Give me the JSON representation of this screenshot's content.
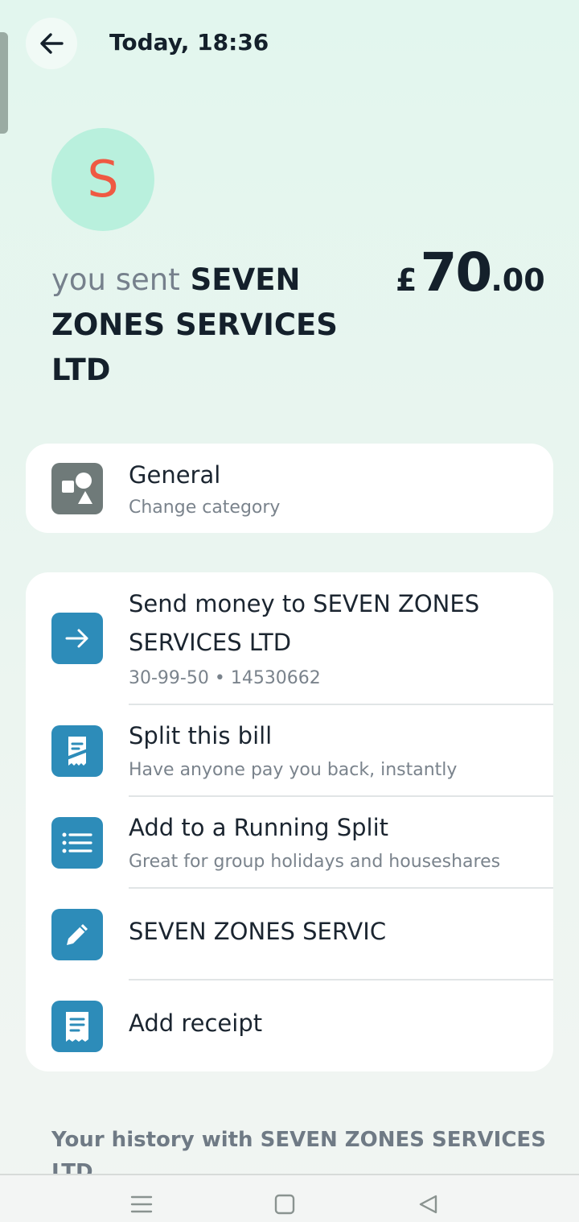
{
  "header": {
    "back_icon": "arrow-left-icon",
    "time": "Today, 18:36"
  },
  "avatar": {
    "letter": "S",
    "color": "#ef5943"
  },
  "transaction": {
    "prefix": "you sent",
    "payee": "SEVEN ZONES SERVICES LTD",
    "currency": "£",
    "amount_major": "70",
    "amount_minor": ".00"
  },
  "category": {
    "icon": "shapes-icon",
    "title": "General",
    "subtitle": "Change category"
  },
  "actions": [
    {
      "icon": "arrow-right-icon",
      "title_line1": "Send money to SEVEN ZONES",
      "title_line2": "SERVICES LTD",
      "subtitle": "30-99-50 • 14530662"
    },
    {
      "icon": "split-bill-icon",
      "title": "Split this bill",
      "subtitle": "Have anyone pay you back, instantly"
    },
    {
      "icon": "list-icon",
      "title": "Add to a Running Split",
      "subtitle": "Great for group holidays and houseshares"
    },
    {
      "icon": "pencil-icon",
      "title": "SEVEN ZONES SERVIC"
    },
    {
      "icon": "receipt-icon",
      "title": "Add receipt"
    }
  ],
  "history": {
    "title": "Your history with SEVEN ZONES SERVICES LTD"
  },
  "navbar": {
    "menu_icon": "menu-icon",
    "home_icon": "square-icon",
    "back_icon": "triangle-back-icon"
  },
  "colors": {
    "accent": "#2d8cb9",
    "avatar_bg": "#b9f0dd",
    "background": "#e6f5ee"
  }
}
